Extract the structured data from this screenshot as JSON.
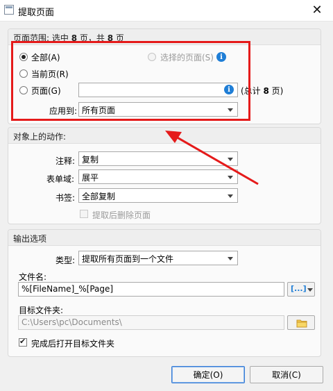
{
  "window": {
    "title": "提取页面",
    "close_label": "✕"
  },
  "page_range": {
    "title_prefix": "页面范围: 选中 ",
    "selected_count": "8",
    "title_middle": " 页，共 ",
    "total_count": "8",
    "title_suffix": " 页",
    "all_label": "全部(A)",
    "selected_pages_label": "选择的页面(S)",
    "current_page_label": "当前页(R)",
    "pages_label": "页面(G)",
    "pages_value": "",
    "count_prefix": "(总计 ",
    "count_value": "8",
    "count_suffix": " 页)",
    "apply_label": "应用到:",
    "apply_value": "所有页面"
  },
  "actions": {
    "title": "对象上的动作:",
    "annot_label": "注释:",
    "annot_value": "复制",
    "form_label": "表单域:",
    "form_value": "展平",
    "bookmark_label": "书签:",
    "bookmark_value": "全部复制",
    "delete_label": "提取后删除页面"
  },
  "output": {
    "title": "输出选项",
    "type_label": "类型:",
    "type_value": "提取所有页面到一个文件",
    "filename_label": "文件名:",
    "filename_value": "%[FileName]_%[Page]",
    "macro_label": "[...]",
    "folder_label": "目标文件夹:",
    "folder_value": "C:\\Users\\pc\\Documents\\",
    "open_label": "完成后打开目标文件夹"
  },
  "buttons": {
    "ok": "确定(O)",
    "cancel": "取消(C)"
  },
  "colors": {
    "highlight": "#e51a1a",
    "accent": "#1f7ed6"
  }
}
